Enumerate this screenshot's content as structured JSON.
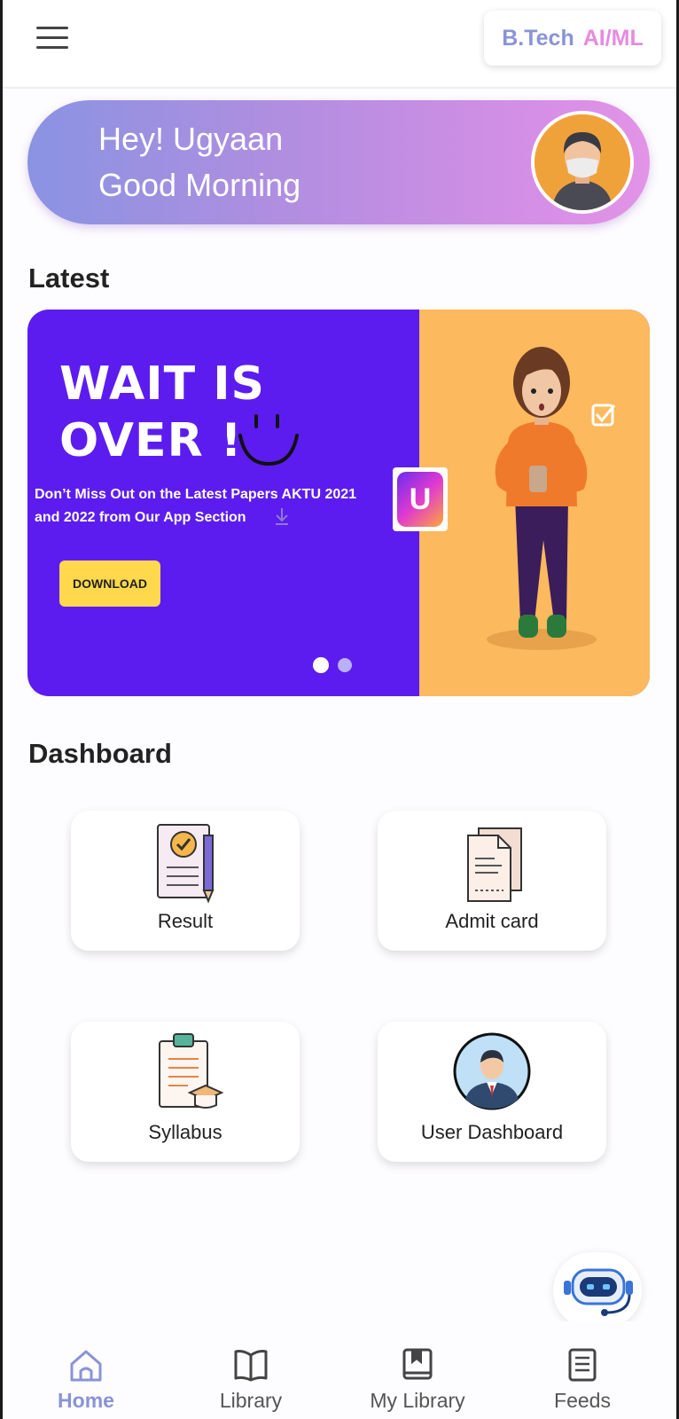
{
  "header": {
    "course_part1": "B.Tech",
    "course_part2": "AI/ML"
  },
  "greeting": {
    "line1": "Hey! Ugyaan",
    "line2": "Good Morning"
  },
  "latest": {
    "title": "Latest",
    "banner": {
      "headline_line1": "WAIT IS",
      "headline_line2": "OVER !",
      "subtitle_line1": "Don’t  Miss Out on the Latest Papers AKTU 2021",
      "subtitle_line2": "and 2022 from Our App  Section",
      "button_label": "DOWNLOAD",
      "app_logo_letter": "U",
      "slide_count": 2,
      "active_slide": 1,
      "colors": {
        "left": "#5c1cf0",
        "right": "#fdb95e",
        "button": "#ffd84c"
      }
    }
  },
  "dashboard": {
    "title": "Dashboard",
    "items": [
      {
        "label": "Result",
        "icon": "result-document-icon"
      },
      {
        "label": "Admit card",
        "icon": "admit-card-icon"
      },
      {
        "label": "Syllabus",
        "icon": "syllabus-clipboard-icon"
      },
      {
        "label": "User Dashboard",
        "icon": "user-avatar-icon"
      }
    ]
  },
  "nav": {
    "items": [
      {
        "label": "Home",
        "icon": "home-icon",
        "active": true
      },
      {
        "label": "Library",
        "icon": "book-icon",
        "active": false
      },
      {
        "label": "My Library",
        "icon": "bookmark-book-icon",
        "active": false
      },
      {
        "label": "Feeds",
        "icon": "feeds-icon",
        "active": false
      }
    ]
  },
  "theme": {
    "accent": "#8a93d6",
    "accent_pink": "#e58be0"
  }
}
